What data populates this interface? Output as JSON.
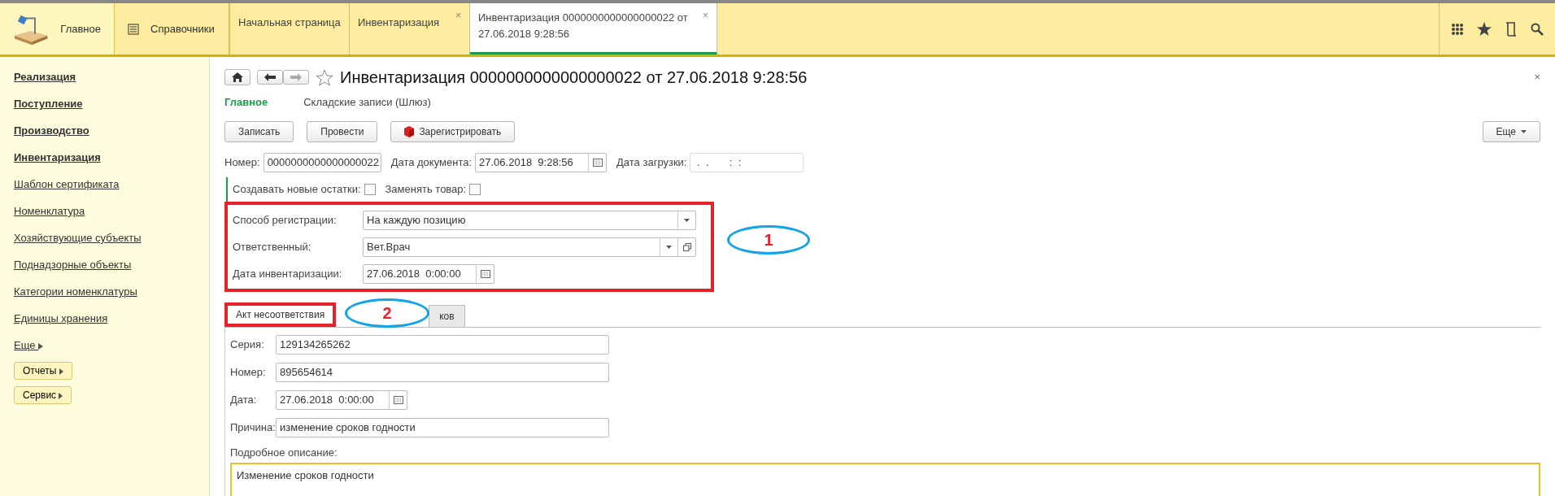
{
  "top_sections": [
    {
      "label": "Главное",
      "kind": "logo",
      "selected": true
    },
    {
      "label": "Справочники",
      "kind": "list",
      "selected": false
    }
  ],
  "open_tabs": [
    {
      "label": "Начальная страница",
      "selected": false
    },
    {
      "label": "Инвентаризация",
      "close": "×",
      "selected": false
    },
    {
      "label": "Инвентаризация 0000000000000000022 от 27.06.2018 9:28:56",
      "close": "×",
      "selected": true
    }
  ],
  "sidebar": {
    "items": [
      {
        "label": "Реализация",
        "kind": "bold"
      },
      {
        "label": "Поступление",
        "kind": "bold"
      },
      {
        "label": "Производство",
        "kind": "bold"
      },
      {
        "label": "Инвентаризация",
        "kind": "bold"
      },
      {
        "label": "Шаблон сертификата",
        "kind": "link"
      },
      {
        "label": "Номенклатура",
        "kind": "link"
      },
      {
        "label": "Хозяйствующие субъекты",
        "kind": "link"
      },
      {
        "label": "Поднадзорные объекты",
        "kind": "link"
      },
      {
        "label": "Категории номенклатуры",
        "kind": "link"
      },
      {
        "label": "Единицы хранения",
        "kind": "link"
      },
      {
        "label": "Еще",
        "kind": "more"
      },
      {
        "label": "Отчеты",
        "kind": "button"
      },
      {
        "label": "Сервис",
        "kind": "button"
      }
    ]
  },
  "document": {
    "title": "Инвентаризация 0000000000000000022 от 27.06.2018 9:28:56",
    "close": "×",
    "sections": [
      {
        "label": "Главное",
        "selected": true
      },
      {
        "label": "Складские записи (Шлюз)",
        "selected": false
      }
    ],
    "buttons": [
      {
        "label": "Записать",
        "kind": "plain"
      },
      {
        "label": "Провести",
        "kind": "plain"
      },
      {
        "label": "Зарегистрировать",
        "kind": "icon"
      }
    ],
    "more_button": "Еще",
    "header_fields": [
      {
        "label": "Номер:",
        "value": "0000000000000000022",
        "kind": "text"
      },
      {
        "label": "Дата документа:",
        "value": "27.06.2018  9:28:56",
        "kind": "date"
      },
      {
        "label": "Дата загрузки:",
        "value": " .  .       :  :",
        "kind": "masked"
      }
    ],
    "checkboxes": [
      {
        "label": "Создавать новые остатки:",
        "checked": false
      },
      {
        "label": "Заменять товар:",
        "checked": false
      }
    ],
    "highlighted_fields": [
      {
        "label": "Способ регистрации:",
        "value": "На каждую позицию",
        "kind": "select"
      },
      {
        "label": "Ответственный:",
        "value": "Вет.Врач",
        "kind": "select_open"
      },
      {
        "label": "Дата инвентаризации:",
        "value": "27.06.2018  0:00:00",
        "kind": "date"
      }
    ],
    "page_tabs": [
      {
        "label": "Акт несоответствия",
        "selected": true
      },
      {
        "label": "ков",
        "selected": false
      }
    ],
    "act_fields": [
      {
        "label": "Серия:",
        "value": "129134265262",
        "kind": "text"
      },
      {
        "label": "Номер:",
        "value": "895654614",
        "kind": "text"
      },
      {
        "label": "Дата:",
        "value": "27.06.2018  0:00:00",
        "kind": "date"
      },
      {
        "label": "Причина:",
        "value": "изменение сроков годности",
        "kind": "text"
      }
    ],
    "description": {
      "label": "Подробное описание:",
      "value": "Изменение сроков годности"
    }
  },
  "annotations": [
    {
      "label": "1"
    },
    {
      "label": "2"
    }
  ]
}
